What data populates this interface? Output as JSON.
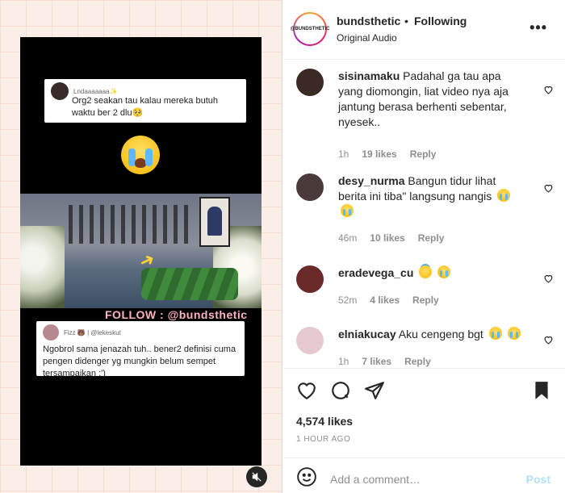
{
  "post": {
    "video": {
      "card1": {
        "username": "Lndaaaaaaa✨",
        "text": "Org2 seakan tau kalau mereka butuh waktu ber 2 dlu🥺"
      },
      "card2": {
        "username": "Fizz 🐻 | @lekeskut",
        "text": "Ngobrol sama jenazah tuh.. bener2 definisi cuma pengen didenger yg mungkin belum sempet tersampaikan :')"
      },
      "watermark": "FOLLOW : @bundsthetic"
    }
  },
  "header": {
    "avatar_text": "@BUNDSTHETIC",
    "username": "bundsthetic",
    "separator": "•",
    "follow_label": "Following",
    "subtitle": "Original Audio",
    "more": "•••"
  },
  "comments": [
    {
      "username": "sisinamaku",
      "text": "Padahal ga tau apa yang diomongin, liat video nya aja jantung berasa berhenti sebentar, nyesek..",
      "time": "1h",
      "likes": "19 likes",
      "reply": "Reply",
      "avatar_color": "#3b2a24"
    },
    {
      "username": "desy_nurma",
      "text": "Bangun tidur lihat berita ini tiba\" langsung nangis",
      "time": "46m",
      "likes": "10 likes",
      "reply": "Reply",
      "avatar_color": "#4a3a3a"
    },
    {
      "username": "eradevega_cu",
      "text": "",
      "time": "52m",
      "likes": "4 likes",
      "reply": "Reply",
      "avatar_color": "#6a2a2a"
    },
    {
      "username": "elniakucay",
      "text": "Aku cengeng bgt",
      "time": "1h",
      "likes": "7 likes",
      "reply": "Reply",
      "avatar_color": "#e6c9cf"
    }
  ],
  "actions": {
    "likes": "4,574 likes",
    "time": "1 HOUR AGO"
  },
  "add_comment": {
    "placeholder": "Add a comment…",
    "post_label": "Post"
  },
  "colors": {
    "accent_post": "#b2dffc",
    "muted": "#8e8e8e",
    "text": "#262626"
  }
}
